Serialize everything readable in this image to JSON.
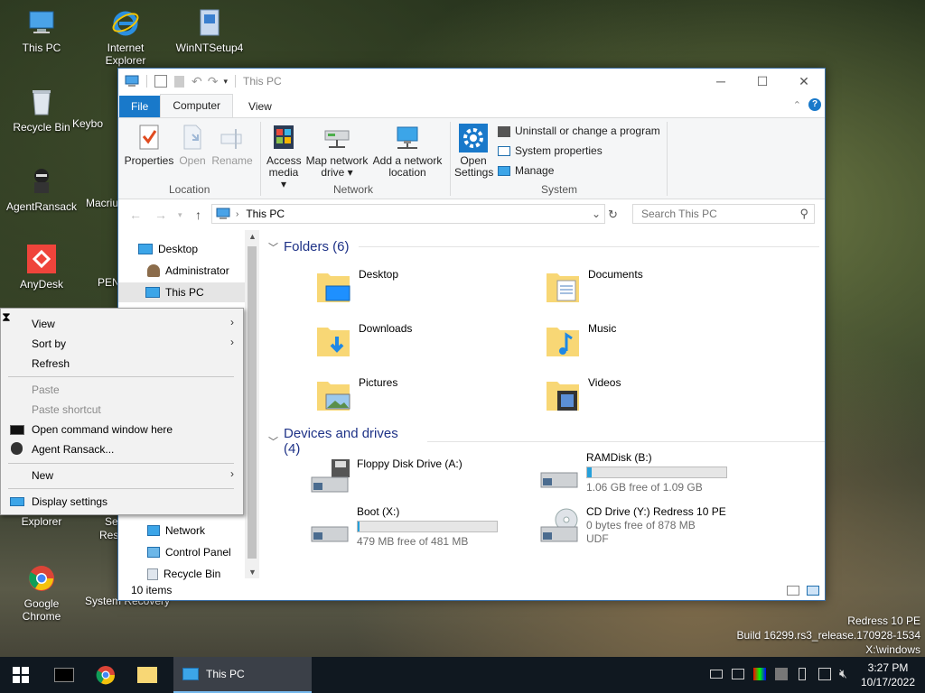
{
  "desktop": {
    "icons": [
      {
        "label": "This PC"
      },
      {
        "label": "Internet Explorer"
      },
      {
        "label": "WinNTSetup4"
      },
      {
        "label": "Recycle Bin"
      },
      {
        "label": "Keybo"
      },
      {
        "label": "AgentRansack"
      },
      {
        "label": "Macriu"
      },
      {
        "label": "AnyDesk"
      },
      {
        "label": "PEN"
      },
      {
        "label": "Explorer"
      },
      {
        "label": "Se"
      },
      {
        "label": "Res"
      },
      {
        "label": "Google Chrome"
      },
      {
        "label": "System Recovery"
      }
    ],
    "watermark": {
      "line1": "Redress 10 PE",
      "line2": "Build 16299.rs3_release.170928-1534",
      "line3": "X:\\windows"
    }
  },
  "window": {
    "title": "This PC",
    "tabs": {
      "file": "File",
      "computer": "Computer",
      "view": "View"
    },
    "ribbon": {
      "properties": "Properties",
      "open": "Open",
      "rename": "Rename",
      "location_group": "Location",
      "access_media_1": "Access",
      "access_media_2": "media ▾",
      "map_drive_1": "Map network",
      "map_drive_2": "drive ▾",
      "add_location_1": "Add a network",
      "add_location_2": "location",
      "network_group": "Network",
      "open_settings_1": "Open",
      "open_settings_2": "Settings",
      "uninstall": "Uninstall or change a program",
      "system_properties": "System properties",
      "manage": "Manage",
      "system_group": "System"
    },
    "address": {
      "path": "This PC",
      "search_placeholder": "Search This PC"
    },
    "nav": {
      "items": [
        {
          "label": "Desktop"
        },
        {
          "label": "Administrator"
        },
        {
          "label": "This PC"
        },
        {
          "label": "Network"
        },
        {
          "label": "Control Panel"
        },
        {
          "label": "Recycle Bin"
        }
      ]
    },
    "folders_header": "Folders (6)",
    "folders": [
      {
        "name": "Desktop"
      },
      {
        "name": "Documents"
      },
      {
        "name": "Downloads"
      },
      {
        "name": "Music"
      },
      {
        "name": "Pictures"
      },
      {
        "name": "Videos"
      }
    ],
    "drives_header": "Devices and drives (4)",
    "drives": [
      {
        "name": "Floppy Disk Drive (A:)",
        "free": ""
      },
      {
        "name": "RAMDisk (B:)",
        "free": "1.06 GB free of 1.09 GB",
        "used_fraction": 0.03
      },
      {
        "name": "Boot (X:)",
        "free": "479 MB free of 481 MB",
        "used_fraction": 0.01
      },
      {
        "name": "CD Drive (Y:) Redress 10 PE",
        "free": "0 bytes free of 878 MB",
        "fs": "UDF"
      }
    ],
    "status": "10 items"
  },
  "context_menu": {
    "view": "View",
    "sort_by": "Sort by",
    "refresh": "Refresh",
    "paste": "Paste",
    "paste_shortcut": "Paste shortcut",
    "open_cmd": "Open command window here",
    "agent_ransack": "Agent Ransack...",
    "new": "New",
    "display_settings": "Display settings"
  },
  "taskbar": {
    "active_window": "This PC",
    "time": "3:27 PM",
    "date": "10/17/2022"
  }
}
